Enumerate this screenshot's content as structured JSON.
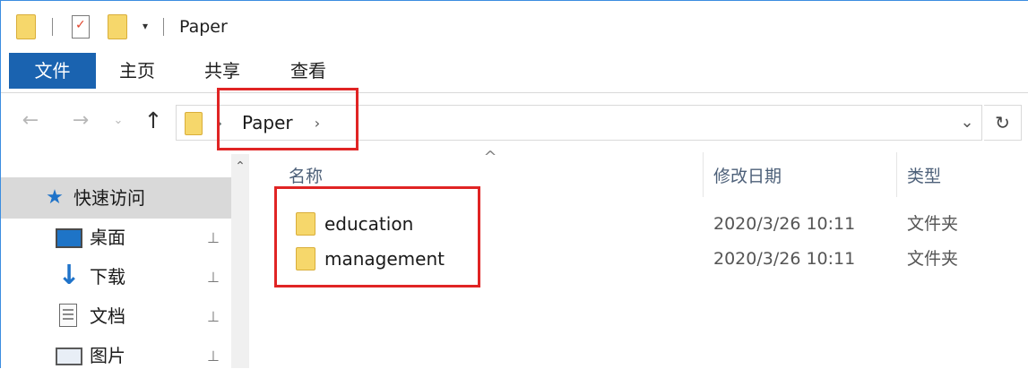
{
  "window": {
    "title": "Paper"
  },
  "quick_access_toolbar": {
    "icons": [
      "folder-icon",
      "properties-check-icon",
      "new-folder-icon",
      "dropdown-icon"
    ]
  },
  "ribbon": {
    "tabs": [
      {
        "label": "文件",
        "active": true
      },
      {
        "label": "主页"
      },
      {
        "label": "共享"
      },
      {
        "label": "查看"
      }
    ],
    "active_color": "#1a63b0"
  },
  "navigation": {
    "back_glyph": "←",
    "forward_glyph": "→",
    "recent_glyph": "⌄",
    "up_glyph": "↑",
    "breadcrumb": [
      "Paper"
    ],
    "separator_glyph": "›",
    "dropdown_glyph": "⌄",
    "refresh_glyph": "↻"
  },
  "nav_pane": {
    "quick_access_label": "快速访问",
    "items": [
      {
        "label": "桌面",
        "icon": "desktop-icon",
        "pinned": true
      },
      {
        "label": "下载",
        "icon": "download-icon",
        "pinned": true
      },
      {
        "label": "文档",
        "icon": "documents-icon",
        "pinned": true
      },
      {
        "label": "图片",
        "icon": "pictures-icon",
        "pinned": true
      }
    ],
    "pin_glyph": "📌"
  },
  "file_list": {
    "columns": {
      "name": "名称",
      "date": "修改日期",
      "type": "类型"
    },
    "sort_glyph": "^",
    "rows": [
      {
        "name": "education",
        "date": "2020/3/26 10:11",
        "type": "文件夹"
      },
      {
        "name": "management",
        "date": "2020/3/26 10:11",
        "type": "文件夹"
      }
    ]
  },
  "annotations": {
    "highlight_color": "#e02424"
  }
}
